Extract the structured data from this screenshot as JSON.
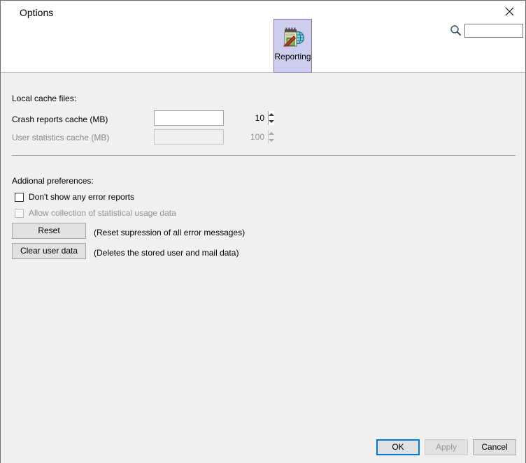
{
  "window": {
    "title": "Options",
    "close_icon": "close-icon"
  },
  "toolbar": {
    "tabs": [
      {
        "id": "reporting",
        "label": "Reporting",
        "icon": "reporting-notepad-globe-icon",
        "selected": true
      }
    ]
  },
  "search": {
    "icon": "search-icon",
    "value": "",
    "placeholder": ""
  },
  "sections": {
    "cache": {
      "heading": "Local cache files:",
      "fields": [
        {
          "label": "Crash reports cache (MB)",
          "value": "10",
          "enabled": true
        },
        {
          "label": "User statistics cache (MB)",
          "value": "100",
          "enabled": false
        }
      ]
    },
    "preferences": {
      "heading": "Addional preferences:",
      "checkboxes": [
        {
          "label": "Don't show any error reports",
          "checked": false,
          "enabled": true
        },
        {
          "label": "Allow collection of statistical usage data",
          "checked": false,
          "enabled": false
        }
      ],
      "actions": [
        {
          "button_label": "Reset",
          "hint": "(Reset supression of all error messages)"
        },
        {
          "button_label": "Clear user data",
          "hint": "(Deletes the stored user and mail data)"
        }
      ]
    }
  },
  "footer": {
    "ok_label": "OK",
    "apply_label": "Apply",
    "cancel_label": "Cancel"
  },
  "colors": {
    "accent": "#0078d7",
    "tab_selected_fill": "#cdcdee",
    "tab_selected_border": "#8b6fb0",
    "panel_background": "#f0f0f0",
    "titlebar_background": "#ffffff"
  }
}
